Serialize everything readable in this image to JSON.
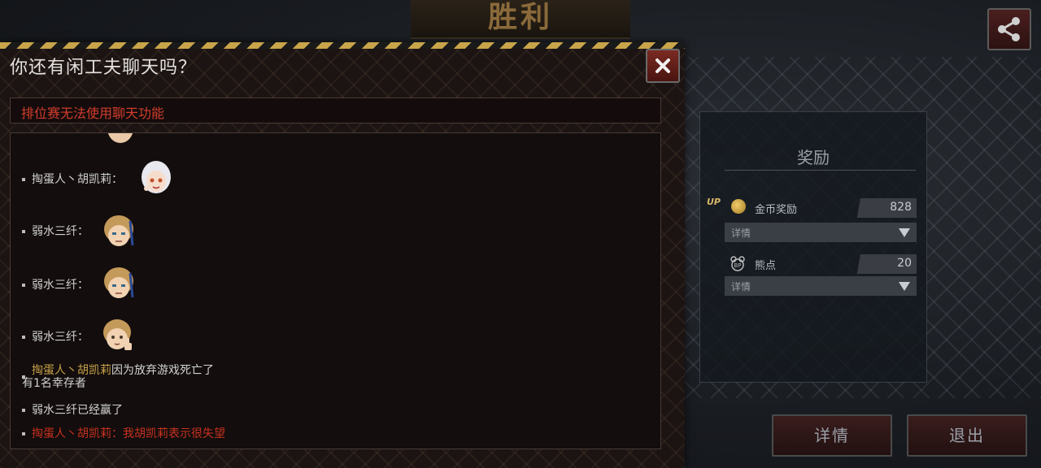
{
  "header": {
    "title": "胜利"
  },
  "share": {
    "icon": "share-icon"
  },
  "chat": {
    "title": "你还有闲工夫聊天吗？",
    "notice": "排位赛无法使用聊天功能",
    "messages": [
      {
        "sender": "掏蛋人丶胡凯莉",
        "sep": "：",
        "avatar": "white-haired-girl-avatar"
      },
      {
        "sender": "弱水三纤",
        "sep": "：",
        "avatar": "blonde-boy-nervous-avatar"
      },
      {
        "sender": "弱水三纤",
        "sep": "：",
        "avatar": "blonde-boy-nervous-avatar"
      },
      {
        "sender": "弱水三纤",
        "sep": "：",
        "avatar": "blonde-boy-thumbsup-avatar"
      }
    ],
    "system1": {
      "name": "掏蛋人丶胡凯莉",
      "text": "因为放弃游戏死亡了",
      "line2": "有1名幸存者"
    },
    "system2": "弱水三纤已经赢了",
    "system3": "掏蛋人丶胡凯莉：我胡凯莉表示很失望"
  },
  "rewards": {
    "title": "奖励",
    "items": [
      {
        "badge": "UP",
        "icon": "gold-coin-icon",
        "label": "金币奖励",
        "value": "828",
        "detail": "详情"
      },
      {
        "icon": "bear-points-icon",
        "label": "熊点",
        "value": "20",
        "detail": "详情"
      }
    ]
  },
  "buttons": {
    "detail": "详情",
    "exit": "退出"
  },
  "colors": {
    "accent_red": "#d23c2c",
    "gold": "#c8a24a"
  }
}
